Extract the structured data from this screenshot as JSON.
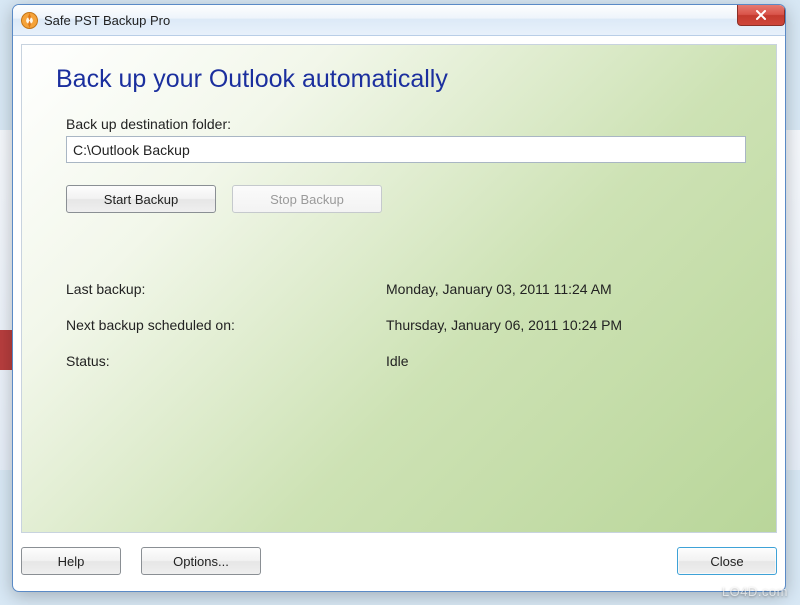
{
  "titlebar": {
    "title": "Safe PST Backup Pro"
  },
  "main": {
    "heading": "Back up your Outlook automatically",
    "dest_label": "Back up destination folder:",
    "dest_value": "C:\\Outlook Backup",
    "start_label": "Start Backup",
    "stop_label": "Stop Backup",
    "info": {
      "last_label": "Last backup:",
      "last_value": "Monday, January 03, 2011 11:24 AM",
      "next_label": "Next backup scheduled on:",
      "next_value": "Thursday, January 06, 2011 10:24 PM",
      "status_label": "Status:",
      "status_value": "Idle"
    }
  },
  "footer": {
    "help": "Help",
    "options": "Options...",
    "close": "Close"
  },
  "watermark": "LO4D.com"
}
